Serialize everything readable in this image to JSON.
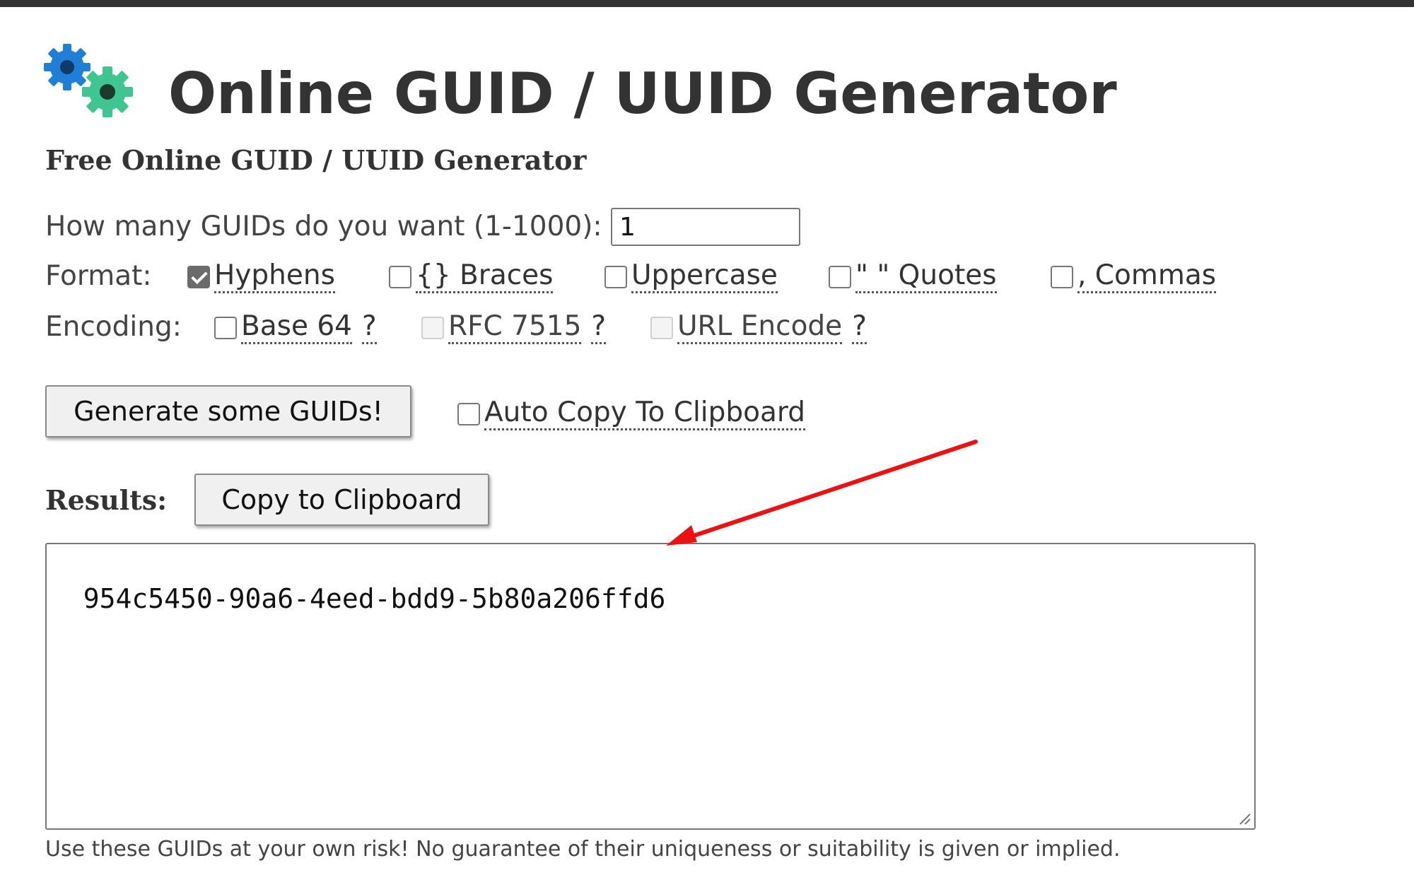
{
  "header": {
    "title": "Online GUID / UUID Generator",
    "subtitle": "Free Online GUID / UUID Generator",
    "logo_icon": "gears-icon"
  },
  "form": {
    "count_label": "How many GUIDs do you want (1-1000):",
    "count_value": "1",
    "format_label": "Format:",
    "format_options": [
      {
        "label": "Hyphens",
        "checked": true
      },
      {
        "label": "{} Braces",
        "checked": false
      },
      {
        "label": "Uppercase",
        "checked": false
      },
      {
        "label": "\" \" Quotes",
        "checked": false
      },
      {
        "label": ", Commas",
        "checked": false
      }
    ],
    "encoding_label": "Encoding:",
    "encoding_options": [
      {
        "label": "Base 64",
        "help": "?",
        "checked": false,
        "disabled": false
      },
      {
        "label": "RFC 7515",
        "help": "?",
        "checked": false,
        "disabled": true
      },
      {
        "label": "URL Encode",
        "help": "?",
        "checked": false,
        "disabled": true
      }
    ],
    "generate_button": "Generate some GUIDs!",
    "auto_copy_label": "Auto Copy To Clipboard"
  },
  "results": {
    "label": "Results:",
    "copy_button": "Copy to Clipboard",
    "value": "954c5450-90a6-4eed-bdd9-5b80a206ffd6",
    "disclaimer": "Use these GUIDs at your own risk! No guarantee of their uniqueness or suitability is given or implied."
  },
  "colors": {
    "gear_blue": "#1f7fd6",
    "gear_green": "#3fc58f",
    "annotation_arrow": "#ee1111"
  }
}
